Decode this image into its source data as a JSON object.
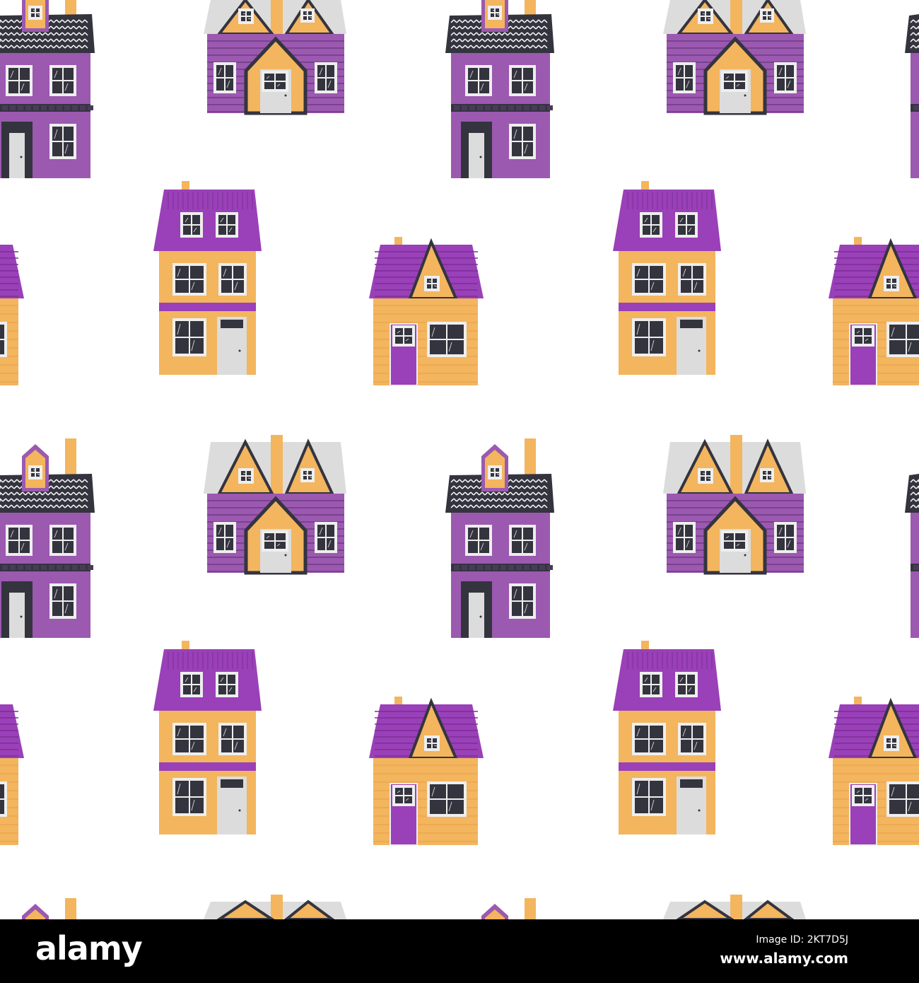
{
  "illustration": {
    "subject": "seamless pattern of houses",
    "colors": {
      "purple_wall": "#9b59b0",
      "purple_roof": "#9a40b8",
      "yellow": "#f3b55e",
      "dark": "#34343f",
      "light_gray": "#dcdcdc",
      "background": "#ffffff"
    }
  },
  "watermark": {
    "logo": "alamy",
    "image_id": "Image ID: 2KT7D5J",
    "url": "www.alamy.com"
  }
}
